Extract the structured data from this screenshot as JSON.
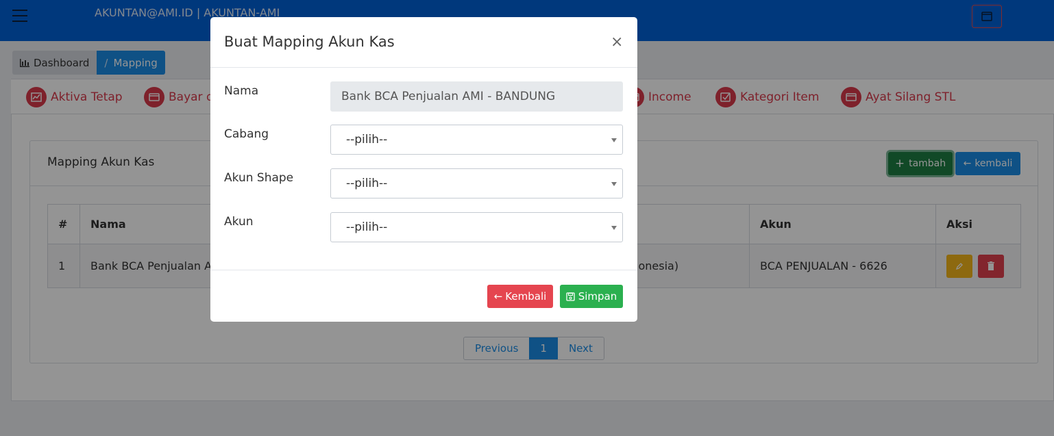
{
  "topbar": {
    "title": "AKUNTAN@AMI.ID | AKUNTAN-AMI"
  },
  "breadcrumb": {
    "items": [
      {
        "label": "Dashboard"
      },
      {
        "label": "Mapping"
      }
    ]
  },
  "tabs": [
    {
      "label": "Aktiva Tetap",
      "icon": "chart-icon"
    },
    {
      "label": "Bayar di",
      "icon": "wallet-icon"
    },
    {
      "label": "Income",
      "icon": "wallet-icon"
    },
    {
      "label": "Kategori Item",
      "icon": "check-square-icon"
    },
    {
      "label": "Ayat Silang STL",
      "icon": "wallet-icon"
    }
  ],
  "card": {
    "title": "Mapping Akun Kas",
    "tambah_label": "tambah",
    "kembali_label": "kembali"
  },
  "table": {
    "headers": [
      "#",
      "Nama",
      "Akun",
      "Aksi"
    ],
    "rows": [
      {
        "no": "1",
        "nama": "Bank BCA Penjualan AM",
        "middle": "onesia)",
        "akun": "BCA PENJUALAN - 6626"
      }
    ]
  },
  "pager": {
    "prev": "Previous",
    "page": "1",
    "next": "Next"
  },
  "modal": {
    "title": "Buat Mapping Akun Kas",
    "close": "×",
    "fields": [
      {
        "label": "Nama",
        "value": "Bank BCA Penjualan AMI - BANDUNG"
      },
      {
        "label": "Cabang",
        "value": "--pilih--"
      },
      {
        "label": "Akun Shape",
        "value": "--pilih--"
      },
      {
        "label": "Akun",
        "value": "--pilih--"
      }
    ],
    "kembali_label": "Kembali",
    "simpan_label": "Simpan"
  },
  "colors": {
    "primary": "#0061d6",
    "danger": "#e5454f",
    "success": "#2bb04f",
    "warning": "#f3b51a",
    "tab_red": "#d9394b"
  }
}
